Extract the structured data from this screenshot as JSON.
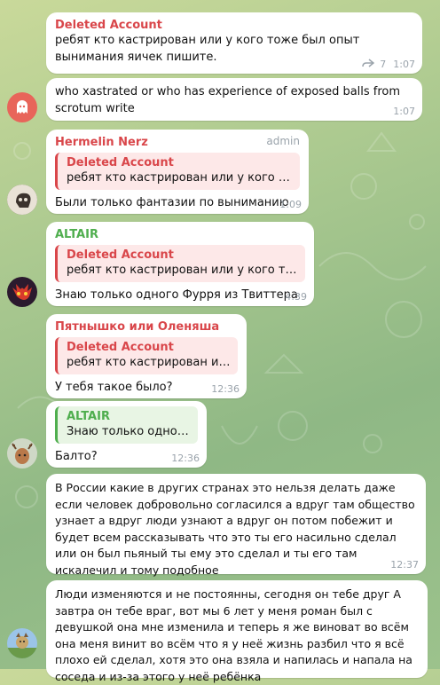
{
  "colors": {
    "deleted": "#d9464a",
    "hermelin": "#d9464a",
    "altair": "#4fae4e",
    "pyatnyshko": "#d9464a"
  },
  "messages": [
    {
      "author": "Deleted Account",
      "text": "ребят кто кастрирован или у кого тоже был опыт вынимания яичек пишите.",
      "reply_icon": "forward-icon",
      "reply_count": "7",
      "time": "1:07"
    },
    {
      "text": "who xastrated or who has experience of exposed balls from scrotum write",
      "time": "1:07",
      "avatar": "ghost-avatar"
    },
    {
      "author": "Hermelin Nerz",
      "badge": "admin",
      "quote_author": "Deleted Account",
      "quote_text": "ребят кто кастрирован или у кого тоже …",
      "text": "Были только фантазии по выниманию",
      "time": "1:09",
      "avatar": "skull-avatar"
    },
    {
      "author": "ALTAIR",
      "quote_author": "Deleted Account",
      "quote_text": "ребят кто кастрирован или у кого тоже б…",
      "text": "Знаю только одного Фурря из Твиттера",
      "time": "4:39",
      "avatar": "red-dragon-avatar"
    },
    {
      "author": "Пятнышко или Оленяша",
      "quote_author": "Deleted Account",
      "quote_text": "ребят кто кастрирован или у …",
      "text": "У тебя такое было?",
      "time": "12:36"
    },
    {
      "quote_author": "ALTAIR",
      "quote_text": "Знаю только одного …",
      "text": "Балто?",
      "time": "12:36",
      "avatar": "deer-avatar"
    },
    {
      "text": "В России какие в других странах это нельзя делать даже если человек добровольно согласился а вдруг там общество узнает а вдруг люди узнают а вдруг он потом побежит и будет всем рассказывать что это ты его насильно сделал или он был пьяный ты ему это сделал и ты его там искалечил и тому подобное",
      "time": "12:37"
    },
    {
      "text": "Люди изменяются и не постоянны, сегодня он тебе друг А завтра он тебе враг, вот мы 6 лет у меня роман был с девушкой она мне изменила и теперь я же виноват во всём она меня винит во всём что я у неё жизнь разбил что я всё плохо ей сделал, хотя это она взяла и напилась и напала на соседа и из-за этого у неё ребёнка",
      "avatar": "cartoon-character-avatar"
    }
  ]
}
